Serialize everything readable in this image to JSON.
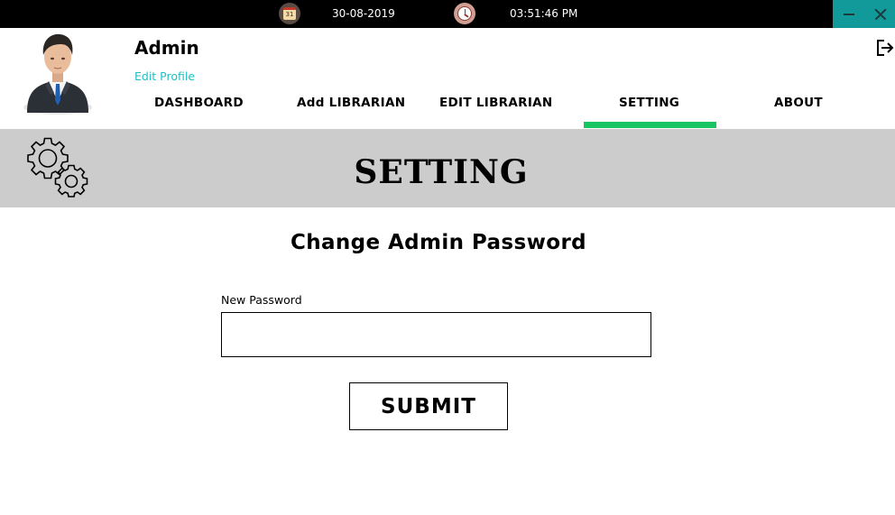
{
  "topbar": {
    "date": "30-08-2019",
    "time": "03:51:46 PM",
    "calendar_day": "31",
    "calendar_icon": "calendar-icon",
    "clock_icon": "clock-icon",
    "controls_color": "#12999a"
  },
  "header": {
    "admin_name": "Admin",
    "edit_profile_label": "Edit Profile",
    "avatar_icon": "admin-avatar",
    "logout_icon": "logout-icon"
  },
  "nav": {
    "items": [
      {
        "label": "DASHBOARD"
      },
      {
        "label": "Add LIBRARIAN"
      },
      {
        "label": "EDIT LIBRARIAN"
      },
      {
        "label": "SETTING"
      },
      {
        "label": "ABOUT"
      }
    ],
    "active_index": 3,
    "active_color": "#17c662"
  },
  "banner": {
    "title": "SETTING",
    "icon": "gears-icon",
    "background": "#cccccc"
  },
  "form": {
    "title": "Change Admin Password",
    "new_password_label": "New Password",
    "new_password_value": "",
    "submit_label": "SUBMIT"
  },
  "colors": {
    "link": "#1ebfc4"
  }
}
